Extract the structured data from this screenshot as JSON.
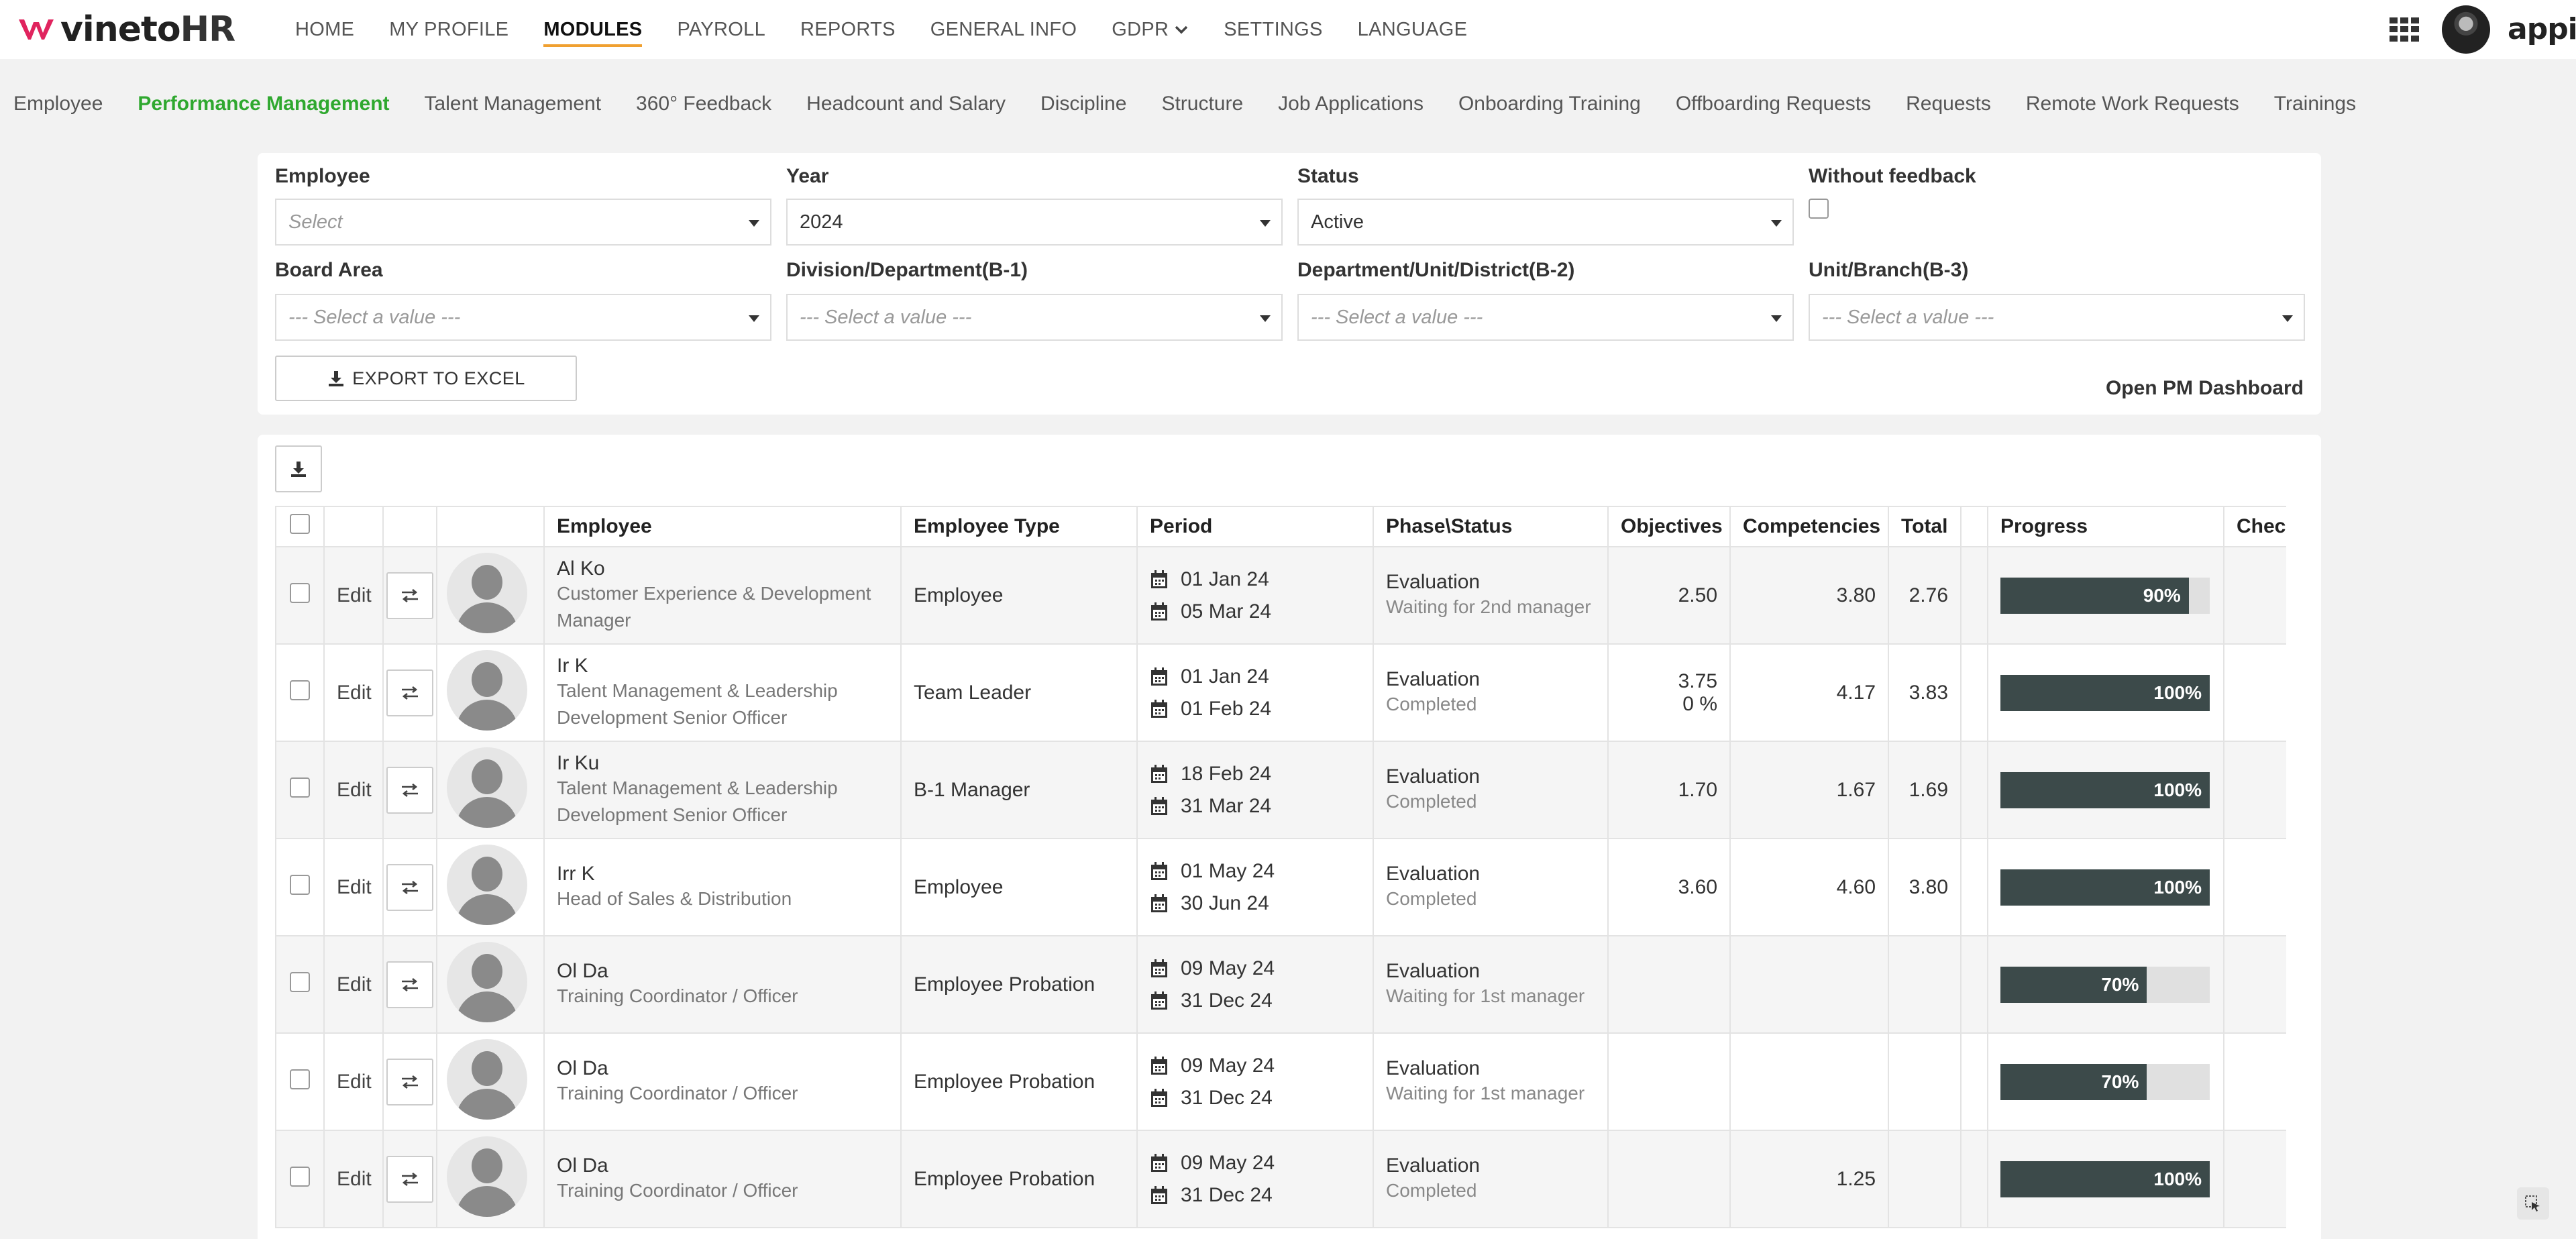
{
  "app": {
    "logo_text": "vineto",
    "logo_suffix": "HR",
    "brand_color": "#e0245e",
    "vendor": "appian"
  },
  "topnav": [
    {
      "label": "HOME"
    },
    {
      "label": "MY PROFILE"
    },
    {
      "label": "MODULES",
      "active": true
    },
    {
      "label": "PAYROLL"
    },
    {
      "label": "REPORTS"
    },
    {
      "label": "GENERAL INFO"
    },
    {
      "label": "GDPR",
      "dropdown": true
    },
    {
      "label": "SETTINGS"
    },
    {
      "label": "LANGUAGE"
    }
  ],
  "subnav": [
    {
      "label": "Employee"
    },
    {
      "label": "Performance Management",
      "active": true
    },
    {
      "label": "Talent Management"
    },
    {
      "label": "360° Feedback"
    },
    {
      "label": "Headcount and Salary"
    },
    {
      "label": "Discipline"
    },
    {
      "label": "Structure"
    },
    {
      "label": "Job Applications"
    },
    {
      "label": "Onboarding Training"
    },
    {
      "label": "Offboarding Requests"
    },
    {
      "label": "Requests"
    },
    {
      "label": "Remote Work Requests"
    },
    {
      "label": "Trainings"
    }
  ],
  "filters": {
    "employee": {
      "label": "Employee",
      "value": "Select"
    },
    "year": {
      "label": "Year",
      "value": "2024"
    },
    "status": {
      "label": "Status",
      "value": "Active"
    },
    "without_feedback": {
      "label": "Without feedback",
      "checked": false
    },
    "board_area": {
      "label": "Board Area",
      "value": "--- Select a value ---"
    },
    "division": {
      "label": "Division/Department(B-1)",
      "value": "--- Select a value ---"
    },
    "department": {
      "label": "Department/Unit/District(B-2)",
      "value": "--- Select a value ---"
    },
    "unit": {
      "label": "Unit/Branch(B-3)",
      "value": "--- Select a value ---"
    },
    "export_label": "EXPORT TO EXCEL",
    "dashboard_link": "Open PM Dashboard"
  },
  "table": {
    "columns": {
      "employee": "Employee",
      "employee_type": "Employee Type",
      "period": "Period",
      "phase_status": "Phase\\Status",
      "objectives": "Objectives",
      "competencies": "Competencies",
      "total": "Total",
      "progress": "Progress",
      "checked": "Checke"
    },
    "edit_label": "Edit",
    "rows": [
      {
        "name": "Al     Ko",
        "role": "Customer Experience & Development Manager",
        "type": "Employee",
        "start": "01 Jan 24",
        "end": "05 Mar 24",
        "phase": "Evaluation",
        "status": "Waiting for 2nd manager",
        "objectives": "2.50",
        "objectives_sub": "",
        "competencies": "3.80",
        "total": "2.76",
        "progress_pct": 90,
        "progress_label": "90%"
      },
      {
        "name": "Ir     K",
        "role": "Talent Management & Leadership Development Senior Officer",
        "type": "Team Leader",
        "start": "01 Jan 24",
        "end": "01 Feb 24",
        "phase": "Evaluation",
        "status": "Completed",
        "objectives": "3.75",
        "objectives_sub": "0 %",
        "competencies": "4.17",
        "total": "3.83",
        "progress_pct": 100,
        "progress_label": "100%"
      },
      {
        "name": "Ir     Ku",
        "role": "Talent Management & Leadership Development Senior Officer",
        "type": "B-1 Manager",
        "start": "18 Feb 24",
        "end": "31 Mar 24",
        "phase": "Evaluation",
        "status": "Completed",
        "objectives": "1.70",
        "objectives_sub": "",
        "competencies": "1.67",
        "total": "1.69",
        "progress_pct": 100,
        "progress_label": "100%"
      },
      {
        "name": "Irr    K",
        "role": "Head of Sales & Distribution",
        "type": "Employee",
        "start": "01 May 24",
        "end": "30 Jun 24",
        "phase": "Evaluation",
        "status": "Completed",
        "objectives": "3.60",
        "objectives_sub": "",
        "competencies": "4.60",
        "total": "3.80",
        "progress_pct": 100,
        "progress_label": "100%"
      },
      {
        "name": "Ol     Da",
        "role": "Training Coordinator / Officer",
        "type": "Employee Probation",
        "start": "09 May 24",
        "end": "31 Dec 24",
        "phase": "Evaluation",
        "status": "Waiting for 1st manager",
        "objectives": "",
        "objectives_sub": "",
        "competencies": "",
        "total": "",
        "progress_pct": 70,
        "progress_label": "70%"
      },
      {
        "name": "Ol     Da",
        "role": "Training Coordinator / Officer",
        "type": "Employee Probation",
        "start": "09 May 24",
        "end": "31 Dec 24",
        "phase": "Evaluation",
        "status": "Waiting for 1st manager",
        "objectives": "",
        "objectives_sub": "",
        "competencies": "",
        "total": "",
        "progress_pct": 70,
        "progress_label": "70%"
      },
      {
        "name": "Ol     Da",
        "role": "Training Coordinator / Officer",
        "type": "Employee Probation",
        "start": "09 May 24",
        "end": "31 Dec 24",
        "phase": "Evaluation",
        "status": "Completed",
        "objectives": "",
        "objectives_sub": "",
        "competencies": "1.25",
        "total": "",
        "progress_pct": 100,
        "progress_label": "100%"
      }
    ]
  }
}
